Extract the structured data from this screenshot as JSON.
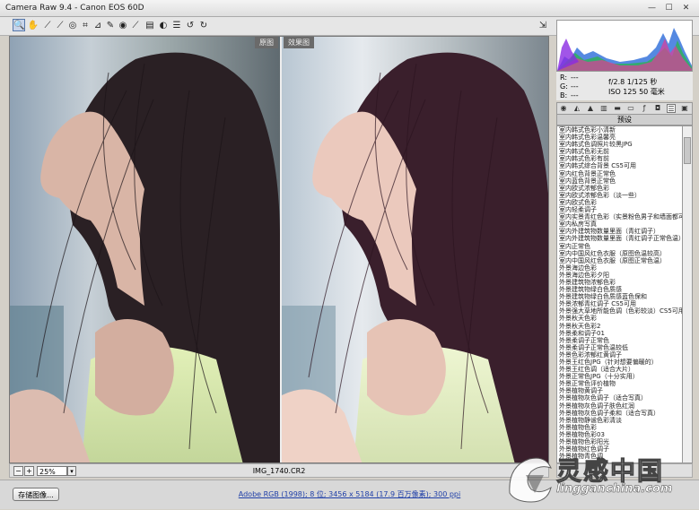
{
  "window": {
    "title": "Camera Raw 9.4 - Canon EOS 60D",
    "buttons": [
      "minimize",
      "maximize",
      "close"
    ]
  },
  "toolbar": {
    "tools": [
      "zoom-tool-icon",
      "hand-tool-icon",
      "white-balance-tool-icon",
      "color-sampler-icon",
      "targeted-adjustment-icon",
      "crop-tool-icon",
      "straighten-tool-icon",
      "spot-removal-icon",
      "red-eye-icon",
      "adjustment-brush-icon",
      "graduated-filter-icon",
      "radial-filter-icon",
      "preferences-icon",
      "rotate-ccw-icon",
      "rotate-cw-icon"
    ],
    "fullscreen_icon": "fullscreen-icon"
  },
  "preview": {
    "before_label": "原图",
    "after_label": "效果图"
  },
  "status": {
    "zoom_minus": "−",
    "zoom_plus": "+",
    "zoom_value": "25%",
    "filename": "IMG_1740.CR2"
  },
  "readout": {
    "r_label": "R:",
    "g_label": "G:",
    "b_label": "B:",
    "r_value": "---",
    "g_value": "---",
    "b_value": "---",
    "aperture_shutter": "f/2.8   1/125 秒",
    "iso_lens": "ISO 125   50 毫米"
  },
  "panel": {
    "title": "预设",
    "tab_icons": [
      "basic-icon",
      "tone-curve-icon",
      "detail-icon",
      "hsl-icon",
      "split-toning-icon",
      "lens-icon",
      "fx-icon",
      "camera-calibration-icon",
      "presets-icon",
      "snapshots-icon"
    ],
    "presets": [
      "室内韩式色彩小清新",
      "室内韩式色彩温馨亮",
      "室内韩式色调照片较黑JPG",
      "室内韩式色彩无前",
      "室内韩式色彩有前",
      "室内韩式综合背景 CS5可用",
      "室内红色背景正常色",
      "室内蓝色背景正常色",
      "室内欧式浓郁色彩",
      "室内欧式浓郁色彩（淡一些）",
      "室内欧式色彩",
      "室内轻柔调子",
      "室内实景青红色彩（实景粉色男子和墙面都可以）",
      "室内私房写真",
      "室内外建筑物数量里面（青红调子）",
      "室内外建筑物数量里面（青红调子正常色温）",
      "室内正常色",
      "室内中国风红色衣服（原图色温较高）",
      "室内中国风红色衣服（原图正常色温）",
      "外景海边色彩",
      "外景海边色彩夕阳",
      "外景建筑物浓郁色彩",
      "外景建筑物绿白色质感",
      "外景建筑物绿白色质感蓝色保和",
      "外景浓郁青红调子 CS5可用",
      "外景强大草地所能色调（色彩较淡）CS5可用",
      "外景秋天色彩",
      "外景秋天色彩2",
      "外景柔和调子01",
      "外景柔调子正常色",
      "外景柔调子正常色温较低",
      "外景色彩浓郁红黄调子",
      "外景王红色JPG（针对想要偏暖的）",
      "外景王红色调（适合大片）",
      "外景正常色JPG（十分实用）",
      "外景正常色评价植物",
      "外景植物黄调子",
      "外景植物灰色调子（适合写真）",
      "外景植物灰色调子肤色红润",
      "外景植物灰色调子柔和（适合写真）",
      "外景植物静谧色彩清淡",
      "外景植物色彩",
      "外景植物色彩03",
      "外景植物色彩阳光",
      "外景植物红色调子",
      "外景植物青色调"
    ]
  },
  "bottom": {
    "save_label": "存储图像...",
    "workflow_link": "Adobe RGB (1998); 8 位; 3456 x 5184 (17.9 百万像素); 300 ppi"
  },
  "watermark": {
    "logo_text": "灵感中国",
    "site": "lingganchina.com"
  },
  "colors": {
    "accent": "#1f3fa8",
    "panel_bg": "#d4d0c8"
  }
}
